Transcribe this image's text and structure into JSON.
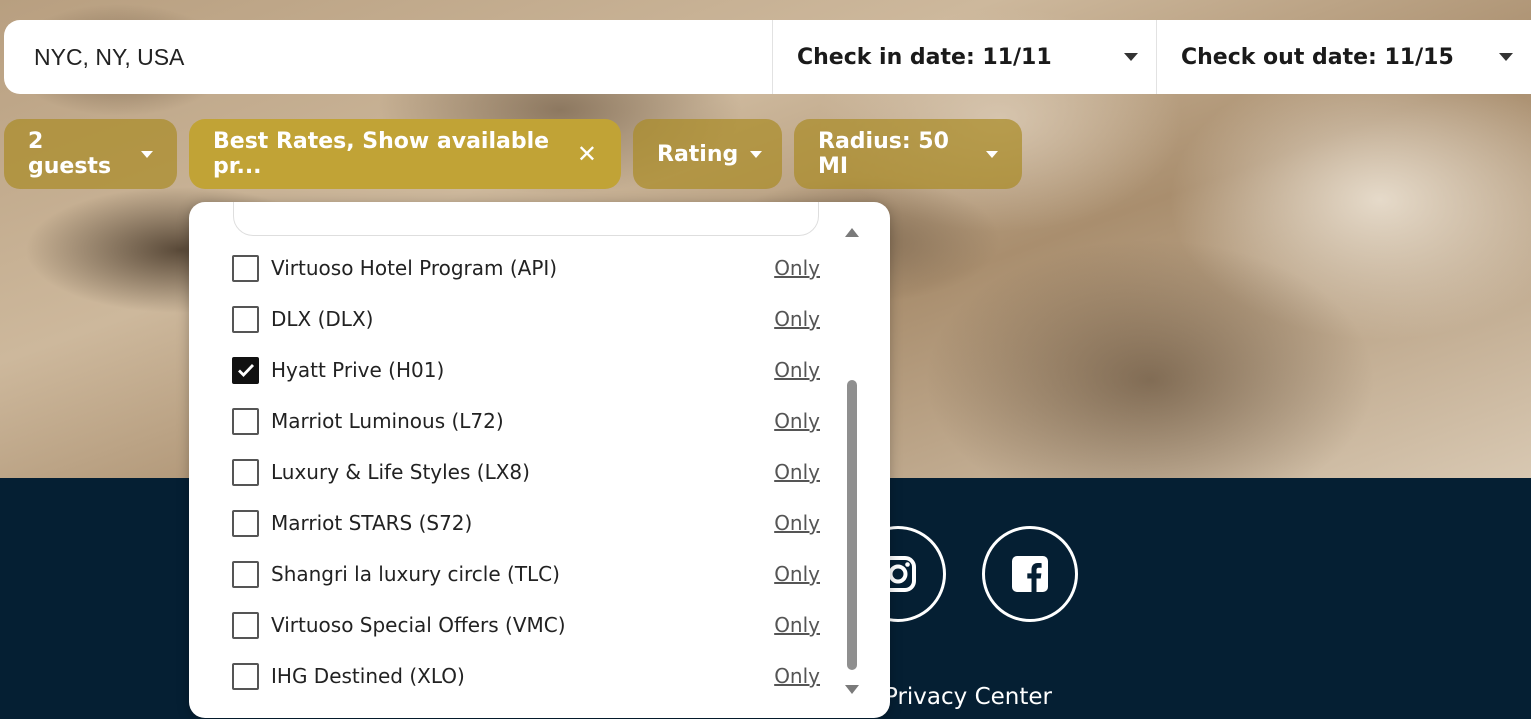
{
  "search": {
    "location_value": "NYC, NY, USA",
    "check_in_label": "Check in date: 11/11",
    "check_out_label": "Check out date: 11/15"
  },
  "filters": {
    "guests_label": "2 guests",
    "rates_label": "Best Rates, Show available pr...",
    "rating_label": "Rating",
    "radius_label": "Radius: 50 MI"
  },
  "rate_programs": {
    "only_label": "Only",
    "options": [
      {
        "label": "Virtuoso Hotel Program (API)",
        "checked": false
      },
      {
        "label": "DLX (DLX)",
        "checked": false
      },
      {
        "label": "Hyatt Prive (H01)",
        "checked": true
      },
      {
        "label": "Marriot Luminous (L72)",
        "checked": false
      },
      {
        "label": "Luxury & Life Styles (LX8)",
        "checked": false
      },
      {
        "label": "Marriot STARS (S72)",
        "checked": false
      },
      {
        "label": "Shangri la luxury circle (TLC)",
        "checked": false
      },
      {
        "label": "Virtuoso Special Offers (VMC)",
        "checked": false
      },
      {
        "label": "IHG Destined (XLO)",
        "checked": false
      }
    ]
  },
  "footer": {
    "privacy_label": "Privacy Center",
    "social_icons": [
      "instagram-icon",
      "facebook-icon"
    ]
  },
  "colors": {
    "accent_gold": "#c1a336",
    "footer_navy": "#051f33"
  }
}
